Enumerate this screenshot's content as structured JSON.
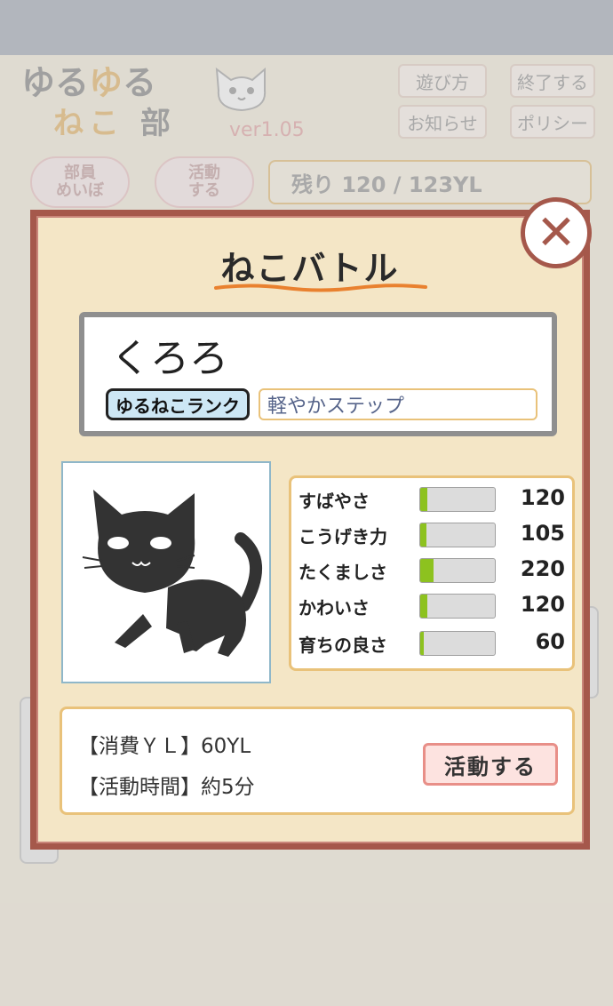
{
  "header": {
    "logo_line1_a": "ゆる",
    "logo_line1_b": "ゆ",
    "logo_line1_c": "る",
    "logo_line2_a": "ねこ",
    "logo_line2_b": "部",
    "version": "ver1.05",
    "buttons": {
      "how_to_play": "遊び方",
      "quit": "終了する",
      "news": "お知らせ",
      "policy": "ポリシー"
    }
  },
  "nav": {
    "member_list_line1": "部員",
    "member_list_line2": "めいぼ",
    "activity_line1": "活動",
    "activity_line2": "する",
    "remaining": "残り 120 / 123YL"
  },
  "modal": {
    "title": "ねこバトル",
    "cat_name": "くろろ",
    "rank_label": "ゆるねこランク",
    "rank_value": "軽やかステップ",
    "stats": [
      {
        "label": "すばやさ",
        "value": "120",
        "fill": 0.09
      },
      {
        "label": "こうげき力",
        "value": "105",
        "fill": 0.08
      },
      {
        "label": "たくましさ",
        "value": "220",
        "fill": 0.18
      },
      {
        "label": "かわいさ",
        "value": "120",
        "fill": 0.09
      },
      {
        "label": "育ちの良さ",
        "value": "60",
        "fill": 0.05
      }
    ],
    "cost_line": "【消費ＹＬ】60YL",
    "time_line": "【活動時間】約5分",
    "action_button": "活動する",
    "close_symbol": "✕"
  },
  "colors": {
    "modal_border": "#a5584b",
    "stat_fill": "#8dc21f",
    "panel_border": "#e9c27a"
  }
}
